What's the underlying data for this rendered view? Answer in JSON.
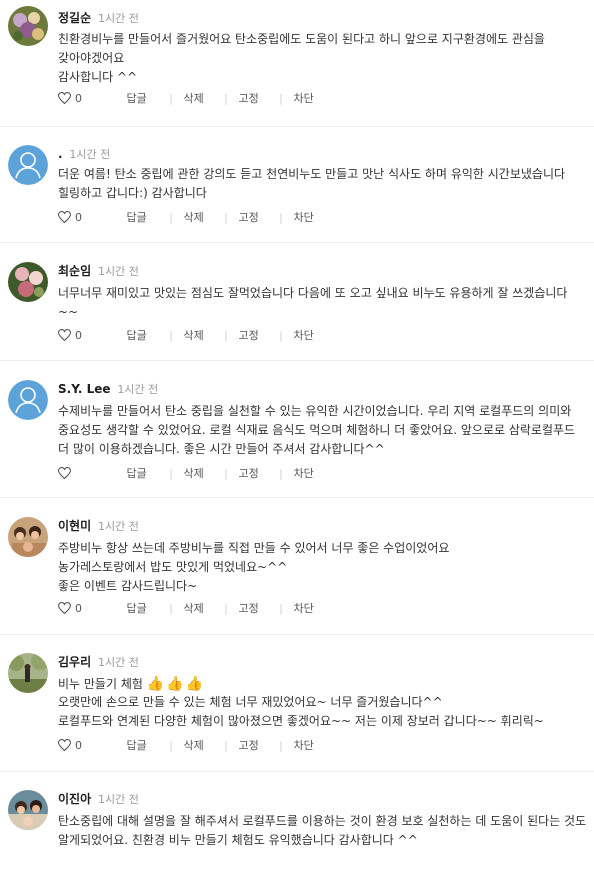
{
  "comments": [
    {
      "author": "정길순",
      "time": "1시간 전",
      "avatar": "photo-flowers",
      "text": "친환경비누를 만들어서 즐거웠어요  탄소중립에도 도움이 된다고 하니 앞으로 지구환경에도 관심을 갖아야겠어요\n감사합니다 ^^",
      "likes": "0"
    },
    {
      "author": ".",
      "time": "1시간 전",
      "avatar": "default-person",
      "text": "더운 여름!  탄소 중립에 관한  강의도 듣고 천연비누도 만들고 맛난 식사도 하며 유익한 시간보냈습니다 힐링하고 갑니다:) 감사합니다",
      "likes": "0"
    },
    {
      "author": "최순임",
      "time": "1시간 전",
      "avatar": "photo-flowers",
      "text": "너무너무 재미있고 맛있는 점심도 잘먹었습니다  다음에 또 오고 싶내요 비누도 유용하게 잘 쓰겠습니다 ~~",
      "likes": "0"
    },
    {
      "author": "S.Y. Lee",
      "time": "1시간 전",
      "avatar": "default-person",
      "text": "수제비누를 만들어서 탄소 중립을 실천할 수 있는 유익한 시간이었습니다. 우리 지역 로컬푸드의 의미와 중요성도 생각할 수 있었어요. 로컬 식재료 음식도 먹으며 체험하니 더 좋았어요.  앞으로로 삼락로컬푸드 더 많이 이용하겠습니다. 좋은 시간 만들어 주셔서 감사합니다^^",
      "likes": ""
    },
    {
      "author": "이현미",
      "time": "1시간 전",
      "avatar": "photo-people",
      "text": "주방비누 항상 쓰는데 주방비누를 직접 만들 수 있어서 너무 좋은 수업이었어요\n농가레스토랑에서 밥도 맛있게 먹었네요~^^\n좋은 이벤트 감사드립니다~",
      "likes": "0"
    },
    {
      "author": "김우리",
      "time": "1시간 전",
      "avatar": "photo-outdoor",
      "text_first": "비누 만들기 체험",
      "thumbs": "👍👍👍",
      "text": "오랫만에 손으로 만들 수 있는 체험 너무 재밌었어요~ 너무 즐거웠습니다^^\n로컬푸드와 연계된 다양한 체험이 많아졌으면 좋겠어요~~ 저는 이제 장보러 갑니다~~ 휘리릭~",
      "likes": "0"
    },
    {
      "author": "이진아",
      "time": "1시간 전",
      "avatar": "photo-people",
      "text": "탄소중립에 대해 설명을 잘 해주셔서 로컬푸드를 이용하는 것이 환경 보호 실천하는 데 도움이 된다는 것도 알게되었어요. 친환경 비누 만들기 체험도 유익했습니다  감사합니다 ^^",
      "likes": ""
    }
  ],
  "actions": {
    "reply": "답글",
    "delete": "삭제",
    "pin": "고정",
    "block": "차단",
    "divider": "|"
  },
  "icons": {
    "like": "heart-outline-icon",
    "default_avatar": "person-silhouette-icon"
  },
  "colors": {
    "default_avatar_bg": "#5ba3d8",
    "author": "#1e1e1e",
    "time": "#9a9a9a",
    "thumbs": "#f3a600"
  }
}
